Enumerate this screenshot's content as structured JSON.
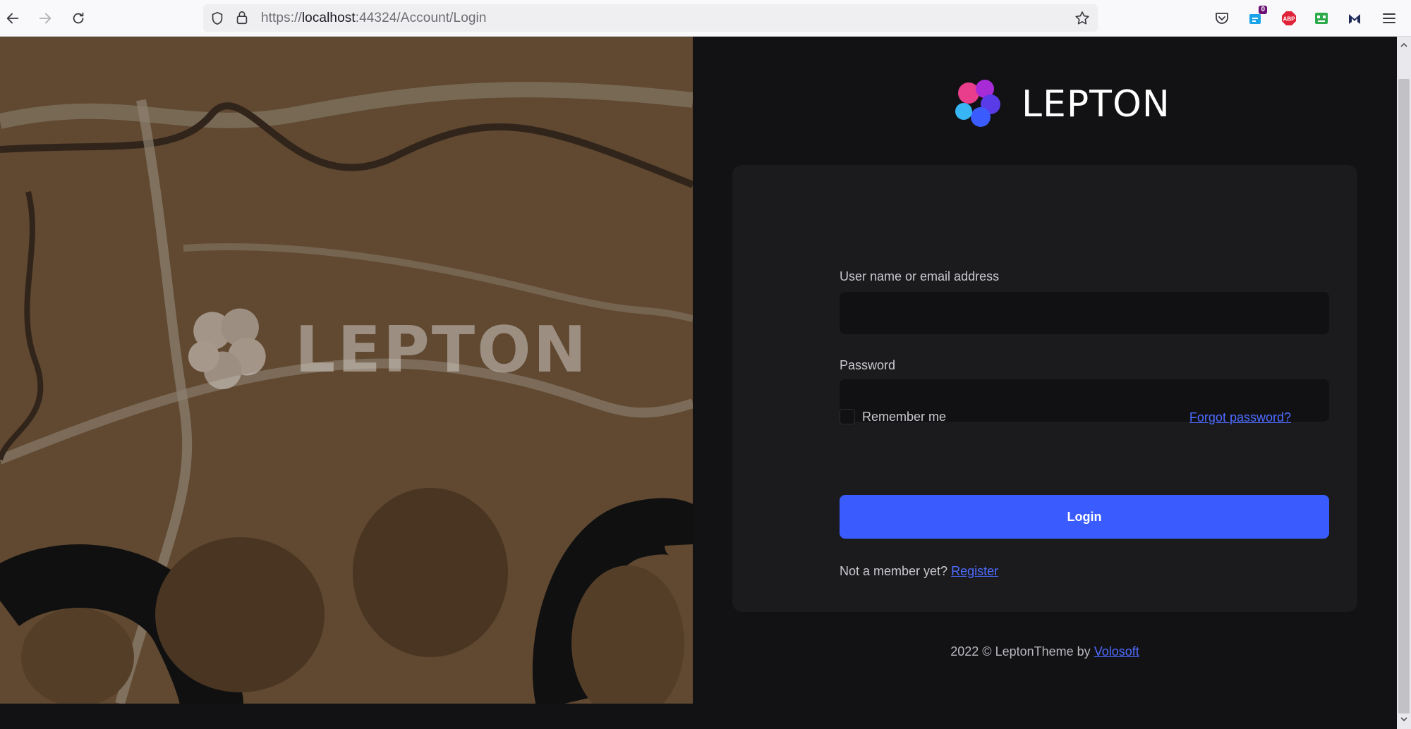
{
  "browser": {
    "url_prefix": "https://",
    "url_host": "localhost",
    "url_rest": ":44324/Account/Login",
    "ext_badge": "0",
    "icons": [
      "back-icon",
      "forward-icon",
      "reload-icon",
      "shield-icon",
      "lock-icon",
      "bookmark-star-icon",
      "pocket-icon",
      "extension-icon",
      "adblock-icon",
      "robot-extension-icon",
      "malwarebytes-icon",
      "menu-icon"
    ]
  },
  "hero": {
    "watermark": "LEPTON"
  },
  "brand": {
    "name": "LEPTON",
    "colors": [
      "#e83e8c",
      "#8b2be2",
      "#3a5cff",
      "#37b5f5"
    ]
  },
  "form": {
    "username_label": "User name or email address",
    "username_value": "",
    "password_label": "Password",
    "password_value": "",
    "remember_label": "Remember me",
    "remember_checked": false,
    "forgot_link": "Forgot password?",
    "login_button": "Login",
    "not_member_text": "Not a member yet?",
    "register_link": "Register"
  },
  "footer": {
    "text": "2022 © LeptonTheme by",
    "link": "Volosoft"
  },
  "colors": {
    "accent": "#3a5cff",
    "link": "#4e6cff",
    "panel": "#121214",
    "card": "#1b1b1d"
  }
}
